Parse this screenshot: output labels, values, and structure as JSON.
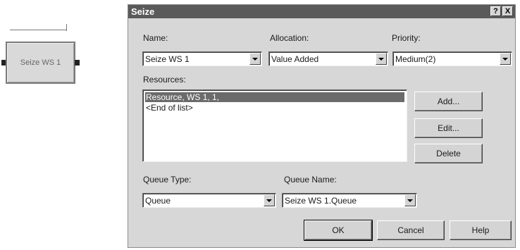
{
  "module": {
    "label": "Seize WS 1"
  },
  "dialog": {
    "title": "Seize",
    "help_glyph": "?",
    "close_glyph": "X",
    "name": {
      "label": "Name:",
      "value": "Seize WS 1"
    },
    "allocation": {
      "label": "Allocation:",
      "value": "Value Added"
    },
    "priority": {
      "label": "Priority:",
      "value": "Medium(2)"
    },
    "resources": {
      "label": "Resources:",
      "items": [
        "Resource, WS 1, 1,",
        "<End of list>"
      ]
    },
    "buttons": {
      "add": "Add...",
      "edit": "Edit...",
      "delete": "Delete"
    },
    "queue_type": {
      "label": "Queue Type:",
      "value": "Queue"
    },
    "queue_name": {
      "label": "Queue Name:",
      "value": "Seize WS 1.Queue"
    },
    "footer": {
      "ok": "OK",
      "cancel": "Cancel",
      "help": "Help"
    }
  }
}
